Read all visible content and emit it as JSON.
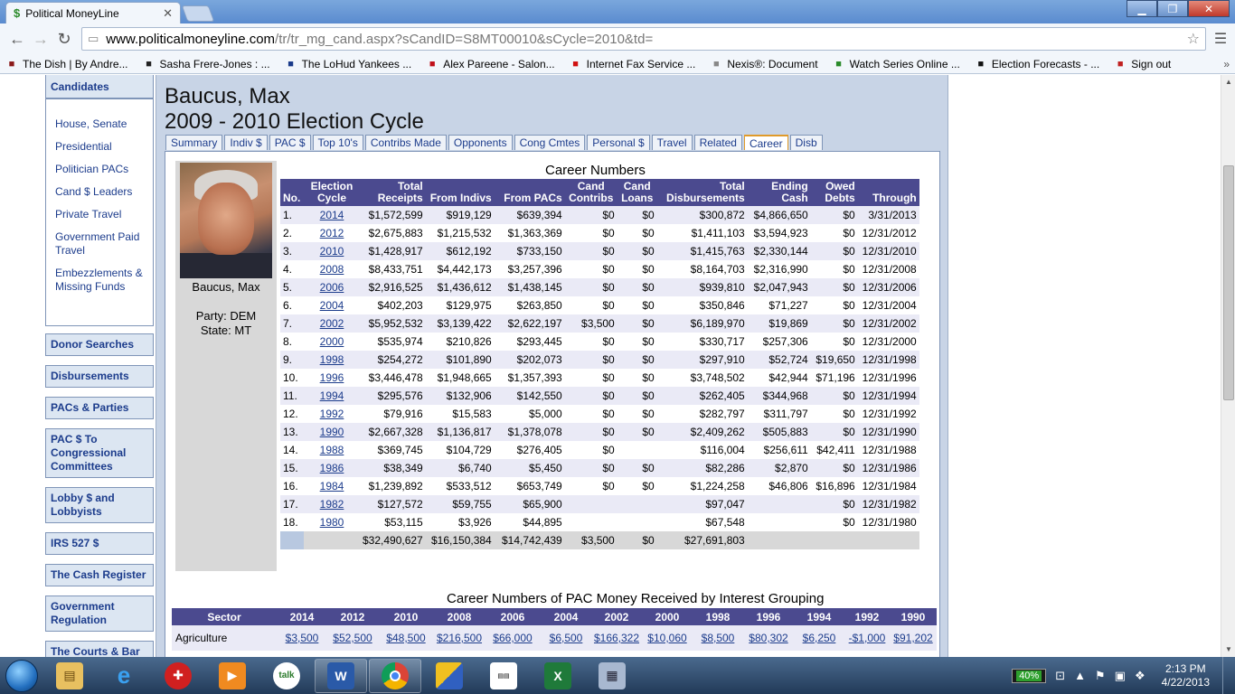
{
  "browser": {
    "tab_title": "Political MoneyLine",
    "tab_close": "✕",
    "url_host": "www.politicalmoneyline.com",
    "url_path": "/tr/tr_mg_cand.aspx?sCandID=S8MT00010&sCycle=2010&td=",
    "bookmarks": [
      {
        "label": "The Dish | By Andre...",
        "icon": "dish-icon",
        "color": "#8b1a1a"
      },
      {
        "label": "Sasha Frere-Jones : ...",
        "icon": "newyorker-icon",
        "color": "#222"
      },
      {
        "label": "The LoHud Yankees ...",
        "icon": "lohud-icon",
        "color": "#1a3a8a"
      },
      {
        "label": "Alex Pareene - Salon...",
        "icon": "salon-icon",
        "color": "#c0101a"
      },
      {
        "label": "Internet Fax Service ...",
        "icon": "efax-icon",
        "color": "#d01010"
      },
      {
        "label": "Nexis®: Document",
        "icon": "document-icon",
        "color": "#888"
      },
      {
        "label": "Watch Series Online ...",
        "icon": "watchseries-icon",
        "color": "#2a8a2a"
      },
      {
        "label": "Election Forecasts - ...",
        "icon": "nyt-icon",
        "color": "#111"
      },
      {
        "label": "Sign out",
        "icon": "gmail-icon",
        "color": "#c02020"
      }
    ]
  },
  "nav": {
    "top": "Candidates",
    "links": [
      "House, Senate",
      "Presidential",
      "Politician PACs",
      "Cand $ Leaders",
      "Private Travel",
      "Government Paid Travel",
      "Embezzlements & Missing Funds"
    ],
    "boxes": [
      "Donor Searches",
      "Disbursements",
      "PACs & Parties",
      "PAC $ To Congressional Committees",
      "Lobby $ and Lobbyists",
      "IRS 527 $",
      "The Cash Register",
      "Government Regulation",
      "The Courts & Bar"
    ]
  },
  "candidate": {
    "name": "Baucus, Max",
    "cycle": "2009 - 2010 Election Cycle",
    "photo_caption": "Baucus, Max",
    "party": "Party: DEM",
    "state": "State: MT"
  },
  "tabs": [
    "Summary",
    "Indiv $",
    "PAC $",
    "Top 10's",
    "Contribs Made",
    "Opponents",
    "Cong Cmtes",
    "Personal $",
    "Travel",
    "Related",
    "Career",
    "Disb"
  ],
  "active_tab": "Career",
  "career": {
    "title": "Career Numbers",
    "headers": [
      "No.",
      "Election Cycle",
      "Total Receipts",
      "From Indivs",
      "From PACs",
      "Cand Contribs",
      "Cand Loans",
      "Total Disbursements",
      "Ending Cash",
      "Owed Debts",
      "Through"
    ],
    "rows": [
      [
        "1.",
        "2014",
        "$1,572,599",
        "$919,129",
        "$639,394",
        "$0",
        "$0",
        "$300,872",
        "$4,866,650",
        "$0",
        "3/31/2013"
      ],
      [
        "2.",
        "2012",
        "$2,675,883",
        "$1,215,532",
        "$1,363,369",
        "$0",
        "$0",
        "$1,411,103",
        "$3,594,923",
        "$0",
        "12/31/2012"
      ],
      [
        "3.",
        "2010",
        "$1,428,917",
        "$612,192",
        "$733,150",
        "$0",
        "$0",
        "$1,415,763",
        "$2,330,144",
        "$0",
        "12/31/2010"
      ],
      [
        "4.",
        "2008",
        "$8,433,751",
        "$4,442,173",
        "$3,257,396",
        "$0",
        "$0",
        "$8,164,703",
        "$2,316,990",
        "$0",
        "12/31/2008"
      ],
      [
        "5.",
        "2006",
        "$2,916,525",
        "$1,436,612",
        "$1,438,145",
        "$0",
        "$0",
        "$939,810",
        "$2,047,943",
        "$0",
        "12/31/2006"
      ],
      [
        "6.",
        "2004",
        "$402,203",
        "$129,975",
        "$263,850",
        "$0",
        "$0",
        "$350,846",
        "$71,227",
        "$0",
        "12/31/2004"
      ],
      [
        "7.",
        "2002",
        "$5,952,532",
        "$3,139,422",
        "$2,622,197",
        "$3,500",
        "$0",
        "$6,189,970",
        "$19,869",
        "$0",
        "12/31/2002"
      ],
      [
        "8.",
        "2000",
        "$535,974",
        "$210,826",
        "$293,445",
        "$0",
        "$0",
        "$330,717",
        "$257,306",
        "$0",
        "12/31/2000"
      ],
      [
        "9.",
        "1998",
        "$254,272",
        "$101,890",
        "$202,073",
        "$0",
        "$0",
        "$297,910",
        "$52,724",
        "$19,650",
        "12/31/1998"
      ],
      [
        "10.",
        "1996",
        "$3,446,478",
        "$1,948,665",
        "$1,357,393",
        "$0",
        "$0",
        "$3,748,502",
        "$42,944",
        "$71,196",
        "12/31/1996"
      ],
      [
        "11.",
        "1994",
        "$295,576",
        "$132,906",
        "$142,550",
        "$0",
        "$0",
        "$262,405",
        "$344,968",
        "$0",
        "12/31/1994"
      ],
      [
        "12.",
        "1992",
        "$79,916",
        "$15,583",
        "$5,000",
        "$0",
        "$0",
        "$282,797",
        "$311,797",
        "$0",
        "12/31/1992"
      ],
      [
        "13.",
        "1990",
        "$2,667,328",
        "$1,136,817",
        "$1,378,078",
        "$0",
        "$0",
        "$2,409,262",
        "$505,883",
        "$0",
        "12/31/1990"
      ],
      [
        "14.",
        "1988",
        "$369,745",
        "$104,729",
        "$276,405",
        "$0",
        "",
        "$116,004",
        "$256,611",
        "$42,411",
        "12/31/1988"
      ],
      [
        "15.",
        "1986",
        "$38,349",
        "$6,740",
        "$5,450",
        "$0",
        "$0",
        "$82,286",
        "$2,870",
        "$0",
        "12/31/1986"
      ],
      [
        "16.",
        "1984",
        "$1,239,892",
        "$533,512",
        "$653,749",
        "$0",
        "$0",
        "$1,224,258",
        "$46,806",
        "$16,896",
        "12/31/1984"
      ],
      [
        "17.",
        "1982",
        "$127,572",
        "$59,755",
        "$65,900",
        "",
        "",
        "$97,047",
        "",
        "$0",
        "12/31/1982"
      ],
      [
        "18.",
        "1980",
        "$53,115",
        "$3,926",
        "$44,895",
        "",
        "",
        "$67,548",
        "",
        "$0",
        "12/31/1980"
      ]
    ],
    "totals": [
      "$32,490,627",
      "$16,150,384",
      "$14,742,439",
      "$3,500",
      "$0",
      "$27,691,803"
    ]
  },
  "pac": {
    "title": "Career Numbers of PAC Money Received by Interest Grouping",
    "headers": [
      "Sector",
      "2014",
      "2012",
      "2010",
      "2008",
      "2006",
      "2004",
      "2002",
      "2000",
      "1998",
      "1996",
      "1994",
      "1992",
      "1990"
    ],
    "rows": [
      [
        "Agriculture",
        "$3,500",
        "$52,500",
        "$48,500",
        "$216,500",
        "$66,000",
        "$6,500",
        "$166,322",
        "$10,060",
        "$8,500",
        "$80,302",
        "$6,250",
        "-$1,000",
        "$91,202"
      ]
    ]
  },
  "taskbar": {
    "battery": "40%",
    "time": "2:13 PM",
    "date": "4/22/2013"
  }
}
